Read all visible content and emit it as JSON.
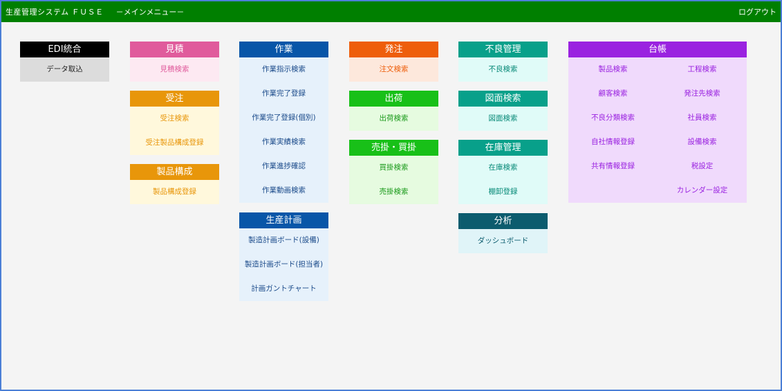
{
  "header": {
    "system_name": "生産管理システム ＦＵＳＥ",
    "menu_title": "－メインメニュー－",
    "logout_label": "ログアウト"
  },
  "colors": {
    "header_bg": "#007f00",
    "edi": "#000000",
    "mitsumori": "#e05b9c",
    "juchu": "#e8960a",
    "sagyo": "#0856a8",
    "hacchu": "#ee5e0b",
    "shukka": "#18c018",
    "furyo": "#08a08a",
    "zumen": "#08a08a",
    "zaiko": "#08a08a",
    "bunseki": "#0c5c6e",
    "daicho": "#9a22e0"
  },
  "panels": {
    "edi": {
      "title": "EDI統合",
      "items": [
        "データ取込"
      ]
    },
    "mitsumori": {
      "title": "見積",
      "items": [
        "見積検索"
      ]
    },
    "juchu": {
      "title": "受注",
      "items": [
        "受注検索",
        "受注製品構成登録"
      ]
    },
    "seihin": {
      "title": "製品構成",
      "items": [
        "製品構成登録"
      ]
    },
    "sagyo": {
      "title": "作業",
      "items": [
        "作業指示検索",
        "作業完了登録",
        "作業完了登録(個別)",
        "作業実績検索",
        "作業進捗確認",
        "作業動画検索"
      ]
    },
    "seisan": {
      "title": "生産計画",
      "items": [
        "製造計画ボード(設備)",
        "製造計画ボード(担当者)",
        "計画ガントチャート"
      ]
    },
    "hacchu": {
      "title": "発注",
      "items": [
        "注文検索"
      ]
    },
    "shukka": {
      "title": "出荷",
      "items": [
        "出荷検索"
      ]
    },
    "urikake": {
      "title": "売掛・買掛",
      "items": [
        "買掛検索",
        "売掛検索"
      ]
    },
    "furyo": {
      "title": "不良管理",
      "items": [
        "不良検索"
      ]
    },
    "zumen": {
      "title": "図面検索",
      "items": [
        "図面検索"
      ]
    },
    "zaiko": {
      "title": "在庫管理",
      "items": [
        "在庫検索",
        "棚卸登録"
      ]
    },
    "bunseki": {
      "title": "分析",
      "items": [
        "ダッシュボード"
      ]
    },
    "daicho": {
      "title": "台帳",
      "items": [
        "製品検索",
        "工程検索",
        "顧客検索",
        "発注先検索",
        "不良分類検索",
        "社員検索",
        "自社情報登録",
        "設備検索",
        "共有情報登録",
        "税設定",
        "",
        "カレンダー設定"
      ]
    }
  }
}
